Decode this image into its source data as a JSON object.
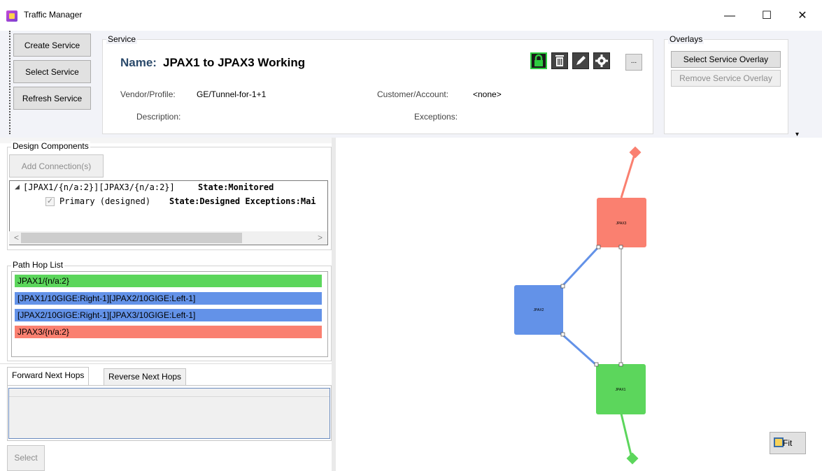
{
  "window": {
    "title": "Traffic Manager",
    "minimize": "—",
    "maximize": "☐",
    "close": "✕"
  },
  "ribbon": {
    "create_service": "Create Service",
    "select_service": "Select Service",
    "refresh_service": "Refresh Service",
    "service_group_title": "Service",
    "name_label": "Name:",
    "name_value": "JPAX1 to JPAX3 Working",
    "vendor_label": "Vendor/Profile:",
    "vendor_value": "GE/Tunnel-for-1+1",
    "description_label": "Description:",
    "customer_label": "Customer/Account:",
    "customer_value": "<none>",
    "exceptions_label": "Exceptions:",
    "more_button": "...",
    "tool_icons": [
      "lock-icon",
      "trash-icon",
      "pencil-icon",
      "gear-icon"
    ],
    "overlays_title": "Overlays",
    "select_overlay": "Select Service Overlay",
    "remove_overlay": "Remove Service Overlay",
    "overflow_glyph": "▾"
  },
  "design": {
    "title": "Design Components",
    "add_connection": "Add Connection(s)",
    "tree_expander": "◢",
    "row1_text": "[JPAX1/{n/a:2}][JPAX3/{n/a:2}]",
    "row1_state": "State:Monitored",
    "row2_text": "Primary (designed)",
    "row2_state": "State:Designed Exceptions:Mai",
    "scroll_left": "<",
    "scroll_right": ">"
  },
  "hops": {
    "title": "Path Hop List",
    "items": [
      {
        "label": "JPAX1/{n/a:2}",
        "color": "#5cd65c"
      },
      {
        "label": "[JPAX1/10GIGE:Right-1][JPAX2/10GIGE:Left-1]",
        "color": "#6392e8"
      },
      {
        "label": "[JPAX2/10GIGE:Right-1][JPAX3/10GIGE:Left-1]",
        "color": "#6392e8"
      },
      {
        "label": "JPAX3/{n/a:2}",
        "color": "#fa8070"
      }
    ]
  },
  "tabs": {
    "forward": "Forward Next Hops",
    "reverse": "Reverse Next Hops",
    "select_button": "Select"
  },
  "graph": {
    "nodes": {
      "jpax3": {
        "label": "JPAX3",
        "color": "#fa8070"
      },
      "jpax2": {
        "label": "JPAX2",
        "color": "#6392e8"
      },
      "jpax1": {
        "label": "JPAX1",
        "color": "#5cd65c"
      }
    },
    "fit_label": "Fit"
  }
}
